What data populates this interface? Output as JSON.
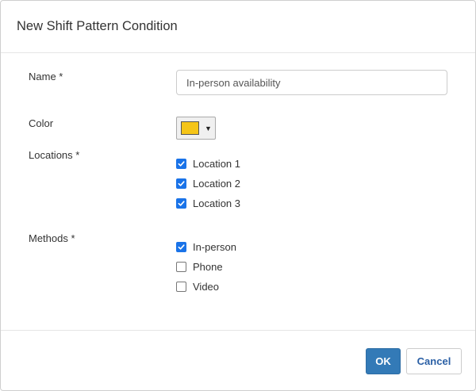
{
  "dialog": {
    "title": "New Shift Pattern Condition"
  },
  "form": {
    "name_label": "Name *",
    "name_value": "In-person availability",
    "color_label": "Color",
    "color_value": "#f5c518",
    "color_caret": "▼",
    "locations_label": "Locations *",
    "locations": [
      {
        "label": "Location 1",
        "checked": true
      },
      {
        "label": "Location 2",
        "checked": true
      },
      {
        "label": "Location 3",
        "checked": true
      }
    ],
    "methods_label": "Methods *",
    "methods": [
      {
        "label": "In-person",
        "checked": true
      },
      {
        "label": "Phone",
        "checked": false
      },
      {
        "label": "Video",
        "checked": false
      }
    ]
  },
  "footer": {
    "ok_label": "OK",
    "cancel_label": "Cancel"
  },
  "colors": {
    "primary": "#337ab7",
    "checkbox_checked": "#1a73e8",
    "link_text": "#2a5fa5"
  },
  "icons": {
    "checkmark": "checkmark-icon",
    "caret": "caret-down-icon"
  }
}
